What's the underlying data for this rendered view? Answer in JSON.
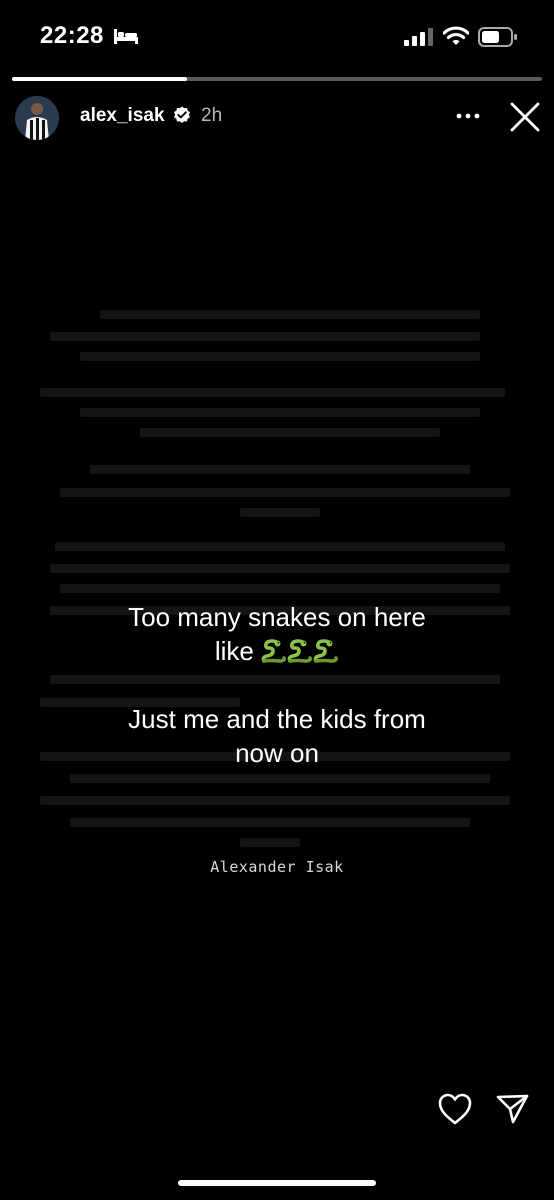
{
  "status_bar": {
    "time": "22:28",
    "icons": [
      "bed-icon",
      "signal-icon",
      "wifi-icon",
      "battery-icon"
    ]
  },
  "story": {
    "progress_fraction": 0.33,
    "username": "alex_isak",
    "verified": true,
    "time_ago": "2h",
    "header_icons": [
      "more-icon",
      "close-icon"
    ]
  },
  "caption": {
    "line1": "Too many snakes on here",
    "line2_text": "like ",
    "line2_emoji": "🐍🐍🐍",
    "line3": "Just me and the kids from",
    "line4": "now on"
  },
  "signature": "Alexander Isak",
  "footer_icons": [
    "heart-icon",
    "send-icon"
  ],
  "colors": {
    "background": "#000000",
    "text": "#ffffff",
    "snake_green": "#8bc34a"
  }
}
